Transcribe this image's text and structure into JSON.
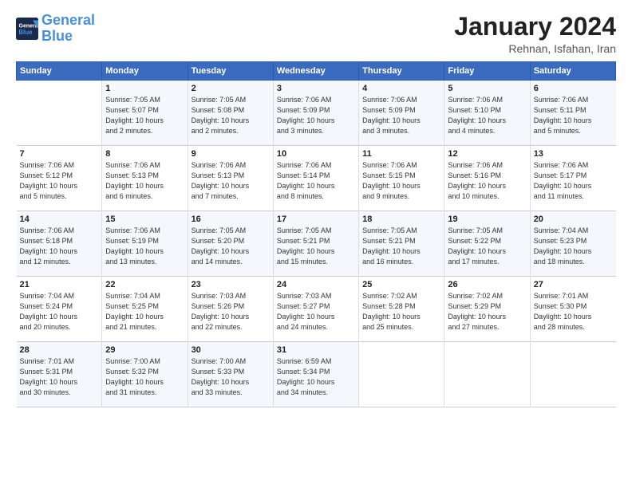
{
  "logo": {
    "line1": "General",
    "line2": "Blue"
  },
  "title": "January 2024",
  "subtitle": "Rehnan, Isfahan, Iran",
  "header_days": [
    "Sunday",
    "Monday",
    "Tuesday",
    "Wednesday",
    "Thursday",
    "Friday",
    "Saturday"
  ],
  "weeks": [
    [
      {
        "day": "",
        "info": ""
      },
      {
        "day": "1",
        "info": "Sunrise: 7:05 AM\nSunset: 5:07 PM\nDaylight: 10 hours\nand 2 minutes."
      },
      {
        "day": "2",
        "info": "Sunrise: 7:05 AM\nSunset: 5:08 PM\nDaylight: 10 hours\nand 2 minutes."
      },
      {
        "day": "3",
        "info": "Sunrise: 7:06 AM\nSunset: 5:09 PM\nDaylight: 10 hours\nand 3 minutes."
      },
      {
        "day": "4",
        "info": "Sunrise: 7:06 AM\nSunset: 5:09 PM\nDaylight: 10 hours\nand 3 minutes."
      },
      {
        "day": "5",
        "info": "Sunrise: 7:06 AM\nSunset: 5:10 PM\nDaylight: 10 hours\nand 4 minutes."
      },
      {
        "day": "6",
        "info": "Sunrise: 7:06 AM\nSunset: 5:11 PM\nDaylight: 10 hours\nand 5 minutes."
      }
    ],
    [
      {
        "day": "7",
        "info": "Sunrise: 7:06 AM\nSunset: 5:12 PM\nDaylight: 10 hours\nand 5 minutes."
      },
      {
        "day": "8",
        "info": "Sunrise: 7:06 AM\nSunset: 5:13 PM\nDaylight: 10 hours\nand 6 minutes."
      },
      {
        "day": "9",
        "info": "Sunrise: 7:06 AM\nSunset: 5:13 PM\nDaylight: 10 hours\nand 7 minutes."
      },
      {
        "day": "10",
        "info": "Sunrise: 7:06 AM\nSunset: 5:14 PM\nDaylight: 10 hours\nand 8 minutes."
      },
      {
        "day": "11",
        "info": "Sunrise: 7:06 AM\nSunset: 5:15 PM\nDaylight: 10 hours\nand 9 minutes."
      },
      {
        "day": "12",
        "info": "Sunrise: 7:06 AM\nSunset: 5:16 PM\nDaylight: 10 hours\nand 10 minutes."
      },
      {
        "day": "13",
        "info": "Sunrise: 7:06 AM\nSunset: 5:17 PM\nDaylight: 10 hours\nand 11 minutes."
      }
    ],
    [
      {
        "day": "14",
        "info": "Sunrise: 7:06 AM\nSunset: 5:18 PM\nDaylight: 10 hours\nand 12 minutes."
      },
      {
        "day": "15",
        "info": "Sunrise: 7:06 AM\nSunset: 5:19 PM\nDaylight: 10 hours\nand 13 minutes."
      },
      {
        "day": "16",
        "info": "Sunrise: 7:05 AM\nSunset: 5:20 PM\nDaylight: 10 hours\nand 14 minutes."
      },
      {
        "day": "17",
        "info": "Sunrise: 7:05 AM\nSunset: 5:21 PM\nDaylight: 10 hours\nand 15 minutes."
      },
      {
        "day": "18",
        "info": "Sunrise: 7:05 AM\nSunset: 5:21 PM\nDaylight: 10 hours\nand 16 minutes."
      },
      {
        "day": "19",
        "info": "Sunrise: 7:05 AM\nSunset: 5:22 PM\nDaylight: 10 hours\nand 17 minutes."
      },
      {
        "day": "20",
        "info": "Sunrise: 7:04 AM\nSunset: 5:23 PM\nDaylight: 10 hours\nand 18 minutes."
      }
    ],
    [
      {
        "day": "21",
        "info": "Sunrise: 7:04 AM\nSunset: 5:24 PM\nDaylight: 10 hours\nand 20 minutes."
      },
      {
        "day": "22",
        "info": "Sunrise: 7:04 AM\nSunset: 5:25 PM\nDaylight: 10 hours\nand 21 minutes."
      },
      {
        "day": "23",
        "info": "Sunrise: 7:03 AM\nSunset: 5:26 PM\nDaylight: 10 hours\nand 22 minutes."
      },
      {
        "day": "24",
        "info": "Sunrise: 7:03 AM\nSunset: 5:27 PM\nDaylight: 10 hours\nand 24 minutes."
      },
      {
        "day": "25",
        "info": "Sunrise: 7:02 AM\nSunset: 5:28 PM\nDaylight: 10 hours\nand 25 minutes."
      },
      {
        "day": "26",
        "info": "Sunrise: 7:02 AM\nSunset: 5:29 PM\nDaylight: 10 hours\nand 27 minutes."
      },
      {
        "day": "27",
        "info": "Sunrise: 7:01 AM\nSunset: 5:30 PM\nDaylight: 10 hours\nand 28 minutes."
      }
    ],
    [
      {
        "day": "28",
        "info": "Sunrise: 7:01 AM\nSunset: 5:31 PM\nDaylight: 10 hours\nand 30 minutes."
      },
      {
        "day": "29",
        "info": "Sunrise: 7:00 AM\nSunset: 5:32 PM\nDaylight: 10 hours\nand 31 minutes."
      },
      {
        "day": "30",
        "info": "Sunrise: 7:00 AM\nSunset: 5:33 PM\nDaylight: 10 hours\nand 33 minutes."
      },
      {
        "day": "31",
        "info": "Sunrise: 6:59 AM\nSunset: 5:34 PM\nDaylight: 10 hours\nand 34 minutes."
      },
      {
        "day": "",
        "info": ""
      },
      {
        "day": "",
        "info": ""
      },
      {
        "day": "",
        "info": ""
      }
    ]
  ]
}
